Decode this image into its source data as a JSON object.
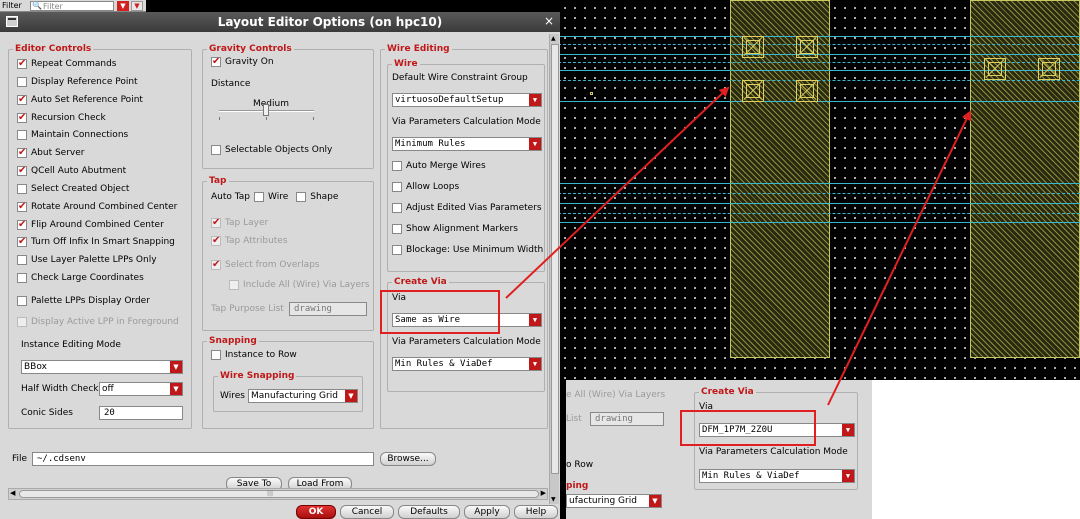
{
  "filter": {
    "label": "Filter",
    "placeholder": "Filter"
  },
  "dialog": {
    "title": "Layout Editor Options (on hpc10)",
    "close": "×",
    "editor_controls": {
      "title": "Editor Controls",
      "items": [
        {
          "label": "Repeat Commands",
          "checked": true,
          "disabled": false
        },
        {
          "label": "Display Reference Point",
          "checked": false,
          "disabled": false
        },
        {
          "label": "Auto Set Reference Point",
          "checked": true,
          "disabled": false
        },
        {
          "label": "Recursion Check",
          "checked": true,
          "disabled": false
        },
        {
          "label": "Maintain Connections",
          "checked": false,
          "disabled": false
        },
        {
          "label": "Abut Server",
          "checked": true,
          "disabled": false
        },
        {
          "label": "QCell Auto Abutment",
          "checked": true,
          "disabled": false
        },
        {
          "label": "Select Created Object",
          "checked": false,
          "disabled": false
        },
        {
          "label": "Rotate Around Combined Center",
          "checked": true,
          "disabled": false
        },
        {
          "label": "Flip Around Combined Center",
          "checked": true,
          "disabled": false
        },
        {
          "label": "Turn Off Infix In Smart Snapping",
          "checked": true,
          "disabled": false
        },
        {
          "label": "Use Layer Palette LPPs Only",
          "checked": false,
          "disabled": false
        },
        {
          "label": "Check Large Coordinates",
          "checked": false,
          "disabled": false
        },
        {
          "label": "Palette LPPs Display Order",
          "checked": false,
          "disabled": false
        },
        {
          "label": "Display Active LPP in Foreground",
          "checked": false,
          "disabled": true
        }
      ],
      "instance_editing_mode_label": "Instance Editing Mode",
      "instance_editing_mode_value": "BBox",
      "half_width_check_label": "Half Width Check",
      "half_width_check_value": "off",
      "conic_sides_label": "Conic Sides",
      "conic_sides_value": "20"
    },
    "gravity_controls": {
      "title": "Gravity Controls",
      "gravity_on_label": "Gravity On",
      "distance_label": "Distance",
      "slider_value_label": "Medium",
      "slider_level": 0.48,
      "selectable_objects_only_label": "Selectable Objects Only"
    },
    "tap": {
      "title": "Tap",
      "auto_tap_label": "Auto Tap",
      "wire_label": "Wire",
      "shape_label": "Shape",
      "tap_layer_label": "Tap Layer",
      "tap_attributes_label": "Tap Attributes",
      "select_from_overlaps_label": "Select from Overlaps",
      "include_all_label": "Include All (Wire) Via Layers",
      "tap_purpose_list_label": "Tap Purpose List",
      "tap_purpose_list_value": "drawing"
    },
    "snapping": {
      "title": "Snapping",
      "instance_to_row_label": "Instance to Row",
      "wire_snapping_title": "Wire Snapping",
      "wires_label": "Wires",
      "wires_value": "Manufacturing Grid"
    },
    "wire_editing": {
      "title": "Wire Editing",
      "wire_title": "Wire",
      "default_constraint_group_label": "Default Wire Constraint Group",
      "default_constraint_group_value": "virtuosoDefaultSetup",
      "via_params_mode_label": "Via Parameters Calculation Mode",
      "via_params_mode_value": "Minimum Rules",
      "auto_merge_wires_label": "Auto Merge Wires",
      "allow_loops_label": "Allow Loops",
      "adjust_edited_vias_label": "Adjust Edited Vias Parameters",
      "show_alignment_markers_label": "Show Alignment Markers",
      "blockage_label": "Blockage: Use Minimum Width",
      "create_via_title": "Create Via",
      "via_label": "Via",
      "via_value": "Same as Wire",
      "create_via_params_label": "Via Parameters Calculation Mode",
      "create_via_params_value": "Min Rules & ViaDef"
    },
    "file_label": "File",
    "file_value": "~/.cdsenv",
    "browse_label": "Browse...",
    "save_to_label": "Save To",
    "load_from_label": "Load From",
    "buttons": {
      "ok": "OK",
      "cancel": "Cancel",
      "defaults": "Defaults",
      "apply": "Apply",
      "help": "Help"
    }
  },
  "fragment": {
    "include_all_label": "e All (Wire) Via Layers",
    "list_label": "List",
    "list_value": "drawing",
    "row_label": "o Row",
    "snapping_label": "ping",
    "wires_value": "ufacturing Grid",
    "create_via_title": "Create Via",
    "via_label": "Via",
    "via_value": "DFM_1P7M_2Z0U",
    "via_params_label": "Via Parameters Calculation Mode",
    "via_params_value": "Min Rules & ViaDef"
  },
  "colors": {
    "accent_red": "#c01818",
    "highlight_red": "#e02020",
    "wire_cyan": "#3ab8d0",
    "metal_yellow": "#c8c860"
  }
}
